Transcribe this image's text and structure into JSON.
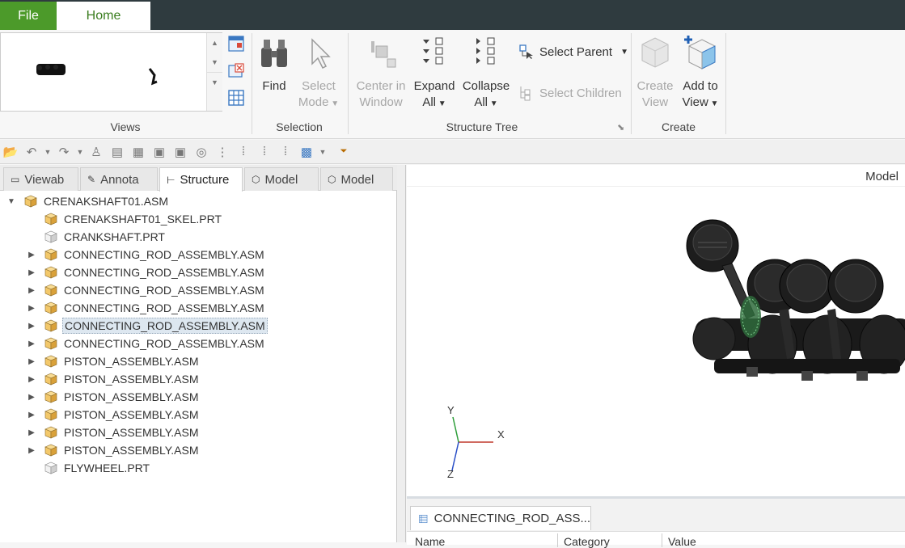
{
  "tabs": {
    "file": "File",
    "home": "Home"
  },
  "ribbon": {
    "views_label": "Views",
    "selection_label": "Selection",
    "structure_tree_label": "Structure Tree",
    "create_label": "Create",
    "find": "Find",
    "select_mode_1": "Select",
    "select_mode_2": "Mode",
    "center_1": "Center in",
    "center_2": "Window",
    "expand_1": "Expand",
    "expand_2": "All",
    "collapse_1": "Collapse",
    "collapse_2": "All",
    "select_parent": "Select Parent",
    "select_children": "Select Children",
    "create_view_1": "Create",
    "create_view_2": "View",
    "add_view_1": "Add to",
    "add_view_2": "View"
  },
  "panel_tabs": [
    "Viewab",
    "Annota",
    "Structure",
    "Model",
    "Model"
  ],
  "tree": [
    {
      "label": "CRENAKSHAFT01.ASM",
      "level": 0,
      "expander": "▼",
      "icon": "assembly-icon",
      "selected": false
    },
    {
      "label": "CRENAKSHAFT01_SKEL.PRT",
      "level": 1,
      "expander": "",
      "icon": "skeleton-part-icon",
      "selected": false
    },
    {
      "label": "CRANKSHAFT.PRT",
      "level": 1,
      "expander": "",
      "icon": "part-icon",
      "selected": false
    },
    {
      "label": "CONNECTING_ROD_ASSEMBLY.ASM",
      "level": 1,
      "expander": "▶",
      "icon": "assembly-icon",
      "selected": false
    },
    {
      "label": "CONNECTING_ROD_ASSEMBLY.ASM",
      "level": 1,
      "expander": "▶",
      "icon": "assembly-icon",
      "selected": false
    },
    {
      "label": "CONNECTING_ROD_ASSEMBLY.ASM",
      "level": 1,
      "expander": "▶",
      "icon": "assembly-icon",
      "selected": false
    },
    {
      "label": "CONNECTING_ROD_ASSEMBLY.ASM",
      "level": 1,
      "expander": "▶",
      "icon": "assembly-icon",
      "selected": false
    },
    {
      "label": "CONNECTING_ROD_ASSEMBLY.ASM",
      "level": 1,
      "expander": "▶",
      "icon": "assembly-icon",
      "selected": true
    },
    {
      "label": "CONNECTING_ROD_ASSEMBLY.ASM",
      "level": 1,
      "expander": "▶",
      "icon": "assembly-icon",
      "selected": false
    },
    {
      "label": "PISTON_ASSEMBLY.ASM",
      "level": 1,
      "expander": "▶",
      "icon": "assembly-icon",
      "selected": false
    },
    {
      "label": "PISTON_ASSEMBLY.ASM",
      "level": 1,
      "expander": "▶",
      "icon": "assembly-icon",
      "selected": false
    },
    {
      "label": "PISTON_ASSEMBLY.ASM",
      "level": 1,
      "expander": "▶",
      "icon": "assembly-icon",
      "selected": false
    },
    {
      "label": "PISTON_ASSEMBLY.ASM",
      "level": 1,
      "expander": "▶",
      "icon": "assembly-icon",
      "selected": false
    },
    {
      "label": "PISTON_ASSEMBLY.ASM",
      "level": 1,
      "expander": "▶",
      "icon": "assembly-icon",
      "selected": false
    },
    {
      "label": "PISTON_ASSEMBLY.ASM",
      "level": 1,
      "expander": "▶",
      "icon": "assembly-icon",
      "selected": false
    },
    {
      "label": "FLYWHEEL.PRT",
      "level": 1,
      "expander": "",
      "icon": "part-icon",
      "selected": false
    }
  ],
  "graphics": {
    "title": "Model",
    "axis_x": "X",
    "axis_y": "Y",
    "axis_z": "Z"
  },
  "bottom_panel": {
    "tab_label": "CONNECTING_ROD_ASS...",
    "col_name": "Name",
    "col_category": "Category",
    "col_value": "Value"
  },
  "colors": {
    "file_tab": "#4c9a2a",
    "home_text": "#3a7d1e",
    "title_bar": "#2f3b3f",
    "selection": "#dde7f0"
  }
}
